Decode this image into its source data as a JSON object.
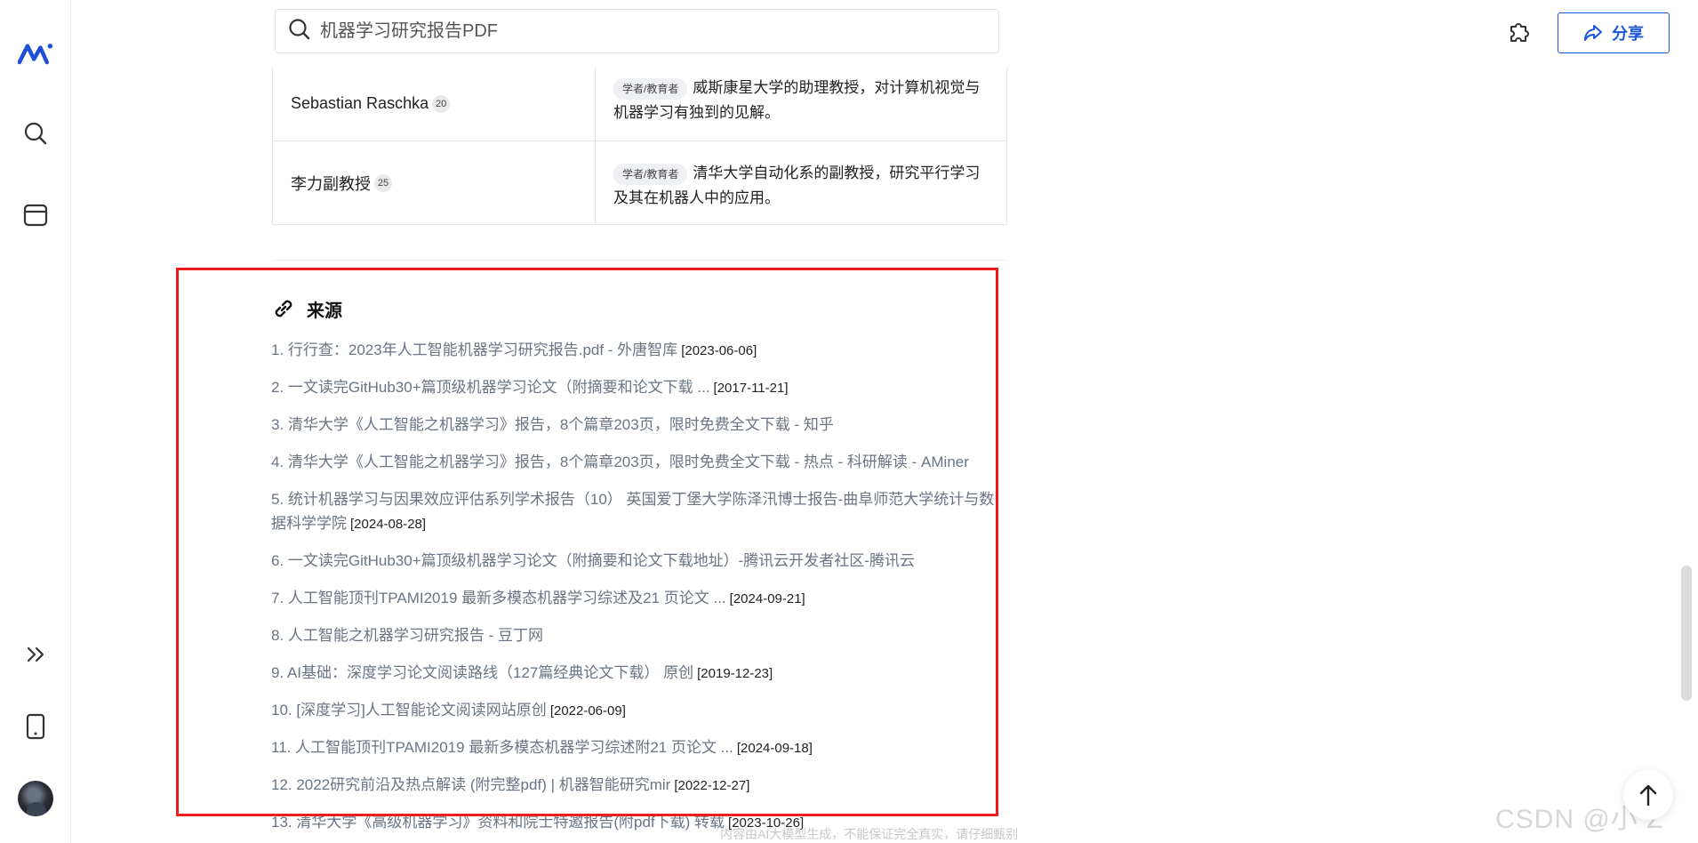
{
  "search": {
    "placeholder": "机器学习研究报告PDF"
  },
  "header": {
    "share_label": "分享"
  },
  "sidebar": {
    "items": [
      {
        "name": "logo",
        "icon": "brand-logo-icon"
      },
      {
        "name": "search",
        "icon": "search-icon"
      },
      {
        "name": "library",
        "icon": "card-icon"
      },
      {
        "name": "expand",
        "icon": "double-chevron-right-icon"
      },
      {
        "name": "mobile",
        "icon": "phone-icon"
      }
    ]
  },
  "table": {
    "rows": [
      {
        "name": "Sebastian Raschka",
        "count": "20",
        "tag": "学者/教育者",
        "desc": "威斯康星大学的助理教授，对计算机视觉与机器学习有独到的见解。"
      },
      {
        "name": "李力副教授",
        "count": "25",
        "tag": "学者/教育者",
        "desc": "清华大学自动化系的副教授，研究平行学习及其在机器人中的应用。"
      }
    ]
  },
  "sources": {
    "title": "来源",
    "items": [
      {
        "text": "1. 行行查：2023年人工智能机器学习研究报告.pdf - 外唐智库",
        "date": "[2023-06-06]"
      },
      {
        "text": "2. 一文读完GitHub30+篇顶级机器学习论文（附摘要和论文下载 ...",
        "date": "[2017-11-21]"
      },
      {
        "text": "3. 清华大学《人工智能之机器学习》报告，8个篇章203页，限时免费全文下载 - 知乎",
        "date": ""
      },
      {
        "text": "4. 清华大学《人工智能之机器学习》报告，8个篇章203页，限时免费全文下载 - 热点 - 科研解读 - AMiner",
        "date": ""
      },
      {
        "text": "5. 统计机器学习与因果效应评估系列学术报告（10） 英国爱丁堡大学陈泽汛博士报告-曲阜师范大学统计与数据科学学院",
        "date": "[2024-08-28]"
      },
      {
        "text": "6. 一文读完GitHub30+篇顶级机器学习论文（附摘要和论文下载地址）-腾讯云开发者社区-腾讯云",
        "date": ""
      },
      {
        "text": "7. 人工智能顶刊TPAMI2019 最新多模态机器学习综述及21 页论文 ...",
        "date": "[2024-09-21]"
      },
      {
        "text": "8. 人工智能之机器学习研究报告 - 豆丁网",
        "date": ""
      },
      {
        "text": "9. AI基础：深度学习论文阅读路线（127篇经典论文下载） 原创",
        "date": "[2019-12-23]"
      },
      {
        "text": "10. [深度学习]人工智能论文阅读网站原创",
        "date": "[2022-06-09]"
      },
      {
        "text": "11. 人工智能顶刊TPAMI2019 最新多模态机器学习综述附21 页论文 ...",
        "date": "[2024-09-18]"
      },
      {
        "text": "12. 2022研究前沿及热点解读 (附完整pdf) | 机器智能研究mir",
        "date": "[2022-12-27]"
      },
      {
        "text": "13. 清华大学《高级机器学习》资料和院士特邀报告(附pdf下载) 转载",
        "date": "[2023-10-26]"
      }
    ]
  },
  "footer": {
    "note": "内容由AI大模型生成，不能保证完全真实，请仔细甄别"
  },
  "watermark": "CSDN @小 Z",
  "colors": {
    "accent": "#1a56db",
    "highlight": "#ee1c1c",
    "link": "#6a7483"
  }
}
